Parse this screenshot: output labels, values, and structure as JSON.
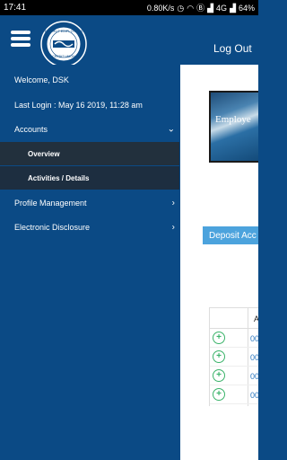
{
  "status_bar": {
    "time": "17:41",
    "network_speed": "0.80K/s",
    "network": "4G",
    "battery": "64%"
  },
  "header": {
    "logout_label": "Log Out",
    "logo_text": "E.C. HUT EMPLOYEES CREDIT UNION",
    "logo_est": "SINCE 1968"
  },
  "drawer": {
    "welcome": "Welcome, DSK",
    "last_login": "Last Login : May 16 2019, 11:28 am",
    "accounts_label": "Accounts",
    "overview_label": "Overview",
    "activities_label": "Activities / Details",
    "profile_label": "Profile Management",
    "disclosure_label": "Electronic Disclosure"
  },
  "main": {
    "banner_text": "Employe",
    "deposit_label": "Deposit Acc",
    "table_header": "Ac",
    "rows": [
      {
        "acct": "00"
      },
      {
        "acct": "00"
      },
      {
        "acct": "00"
      },
      {
        "acct": "00"
      }
    ]
  },
  "colors": {
    "brand_blue": "#0b4a85",
    "sub_item_bg": "#1d2e40",
    "deposit_bar": "#4ca3dd",
    "expand_green": "#3bb36a"
  }
}
